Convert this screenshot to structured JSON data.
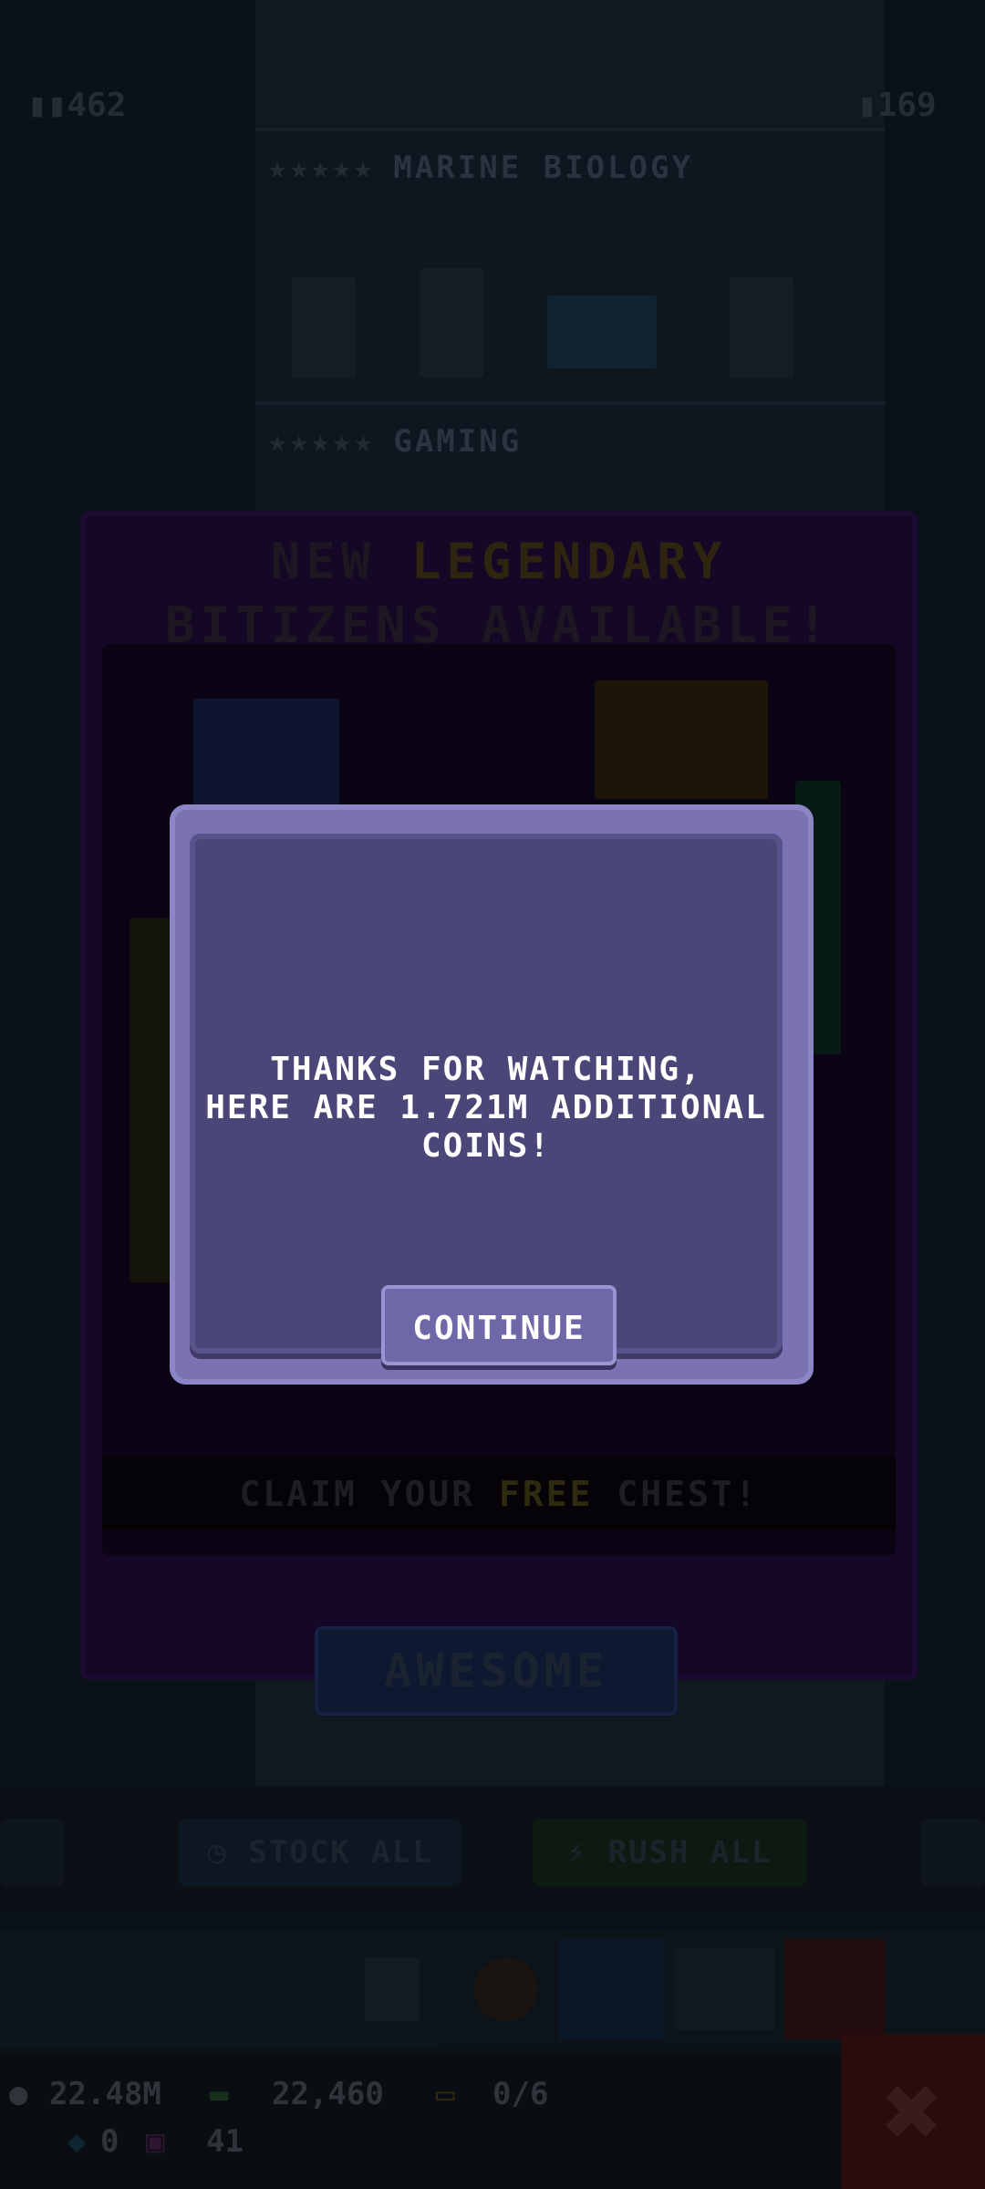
{
  "top_counts": {
    "left": "462",
    "right": "169"
  },
  "floors": [
    {
      "stars": "★★★★★",
      "name": "MARINE BIOLOGY"
    },
    {
      "stars": "★★★★★",
      "name": "GAMING"
    }
  ],
  "legendary_panel": {
    "title_line1_a": "NEW ",
    "title_line1_b": "LEGENDARY",
    "title_line2": "BITIZENS AVAILABLE!",
    "claim_a": "CLAIM YOUR ",
    "claim_b": "FREE",
    "claim_c": " CHEST!",
    "awesome_label": "AWESOME"
  },
  "actions": {
    "stock_all": "STOCK ALL",
    "rush_all": "RUSH ALL"
  },
  "status": {
    "coins": "22.48M",
    "bux": "22,460",
    "tickets": "0/6",
    "gems": "0",
    "level": "41"
  },
  "dialog": {
    "message_line1": "THANKS FOR WATCHING,",
    "message_line2": "HERE ARE 1.721M ADDITIONAL",
    "message_line3": "COINS!",
    "continue_label": "CONTINUE"
  },
  "colors": {
    "dialog_frame": "#7a72b3",
    "dialog_body": "#4b4678",
    "legendary_gold": "#2e2410"
  }
}
